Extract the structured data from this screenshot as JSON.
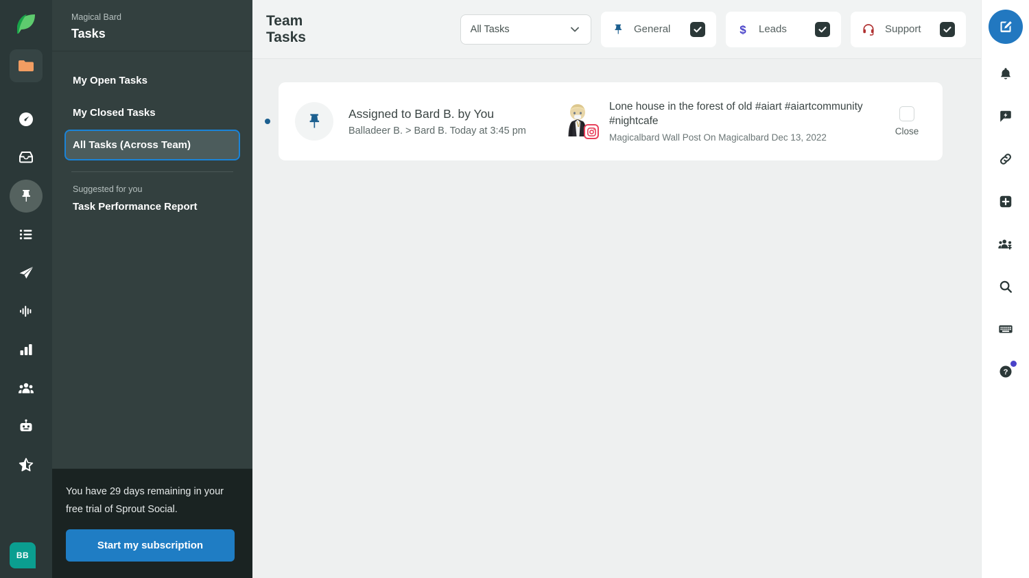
{
  "icon_rail": {
    "logo": "sprout-leaf-logo",
    "folder_icon": "folder-icon",
    "items": [
      {
        "name": "dashboard-icon",
        "label": "Dashboard"
      },
      {
        "name": "inbox-icon",
        "label": "Smart Inbox"
      },
      {
        "name": "pin-icon",
        "label": "Tasks",
        "active": true
      },
      {
        "name": "list-icon",
        "label": "Feeds"
      },
      {
        "name": "paper-plane-icon",
        "label": "Publishing"
      },
      {
        "name": "listening-icon",
        "label": "Listening"
      },
      {
        "name": "bar-chart-icon",
        "label": "Reports"
      },
      {
        "name": "people-icon",
        "label": "Contacts"
      },
      {
        "name": "bot-icon",
        "label": "Bots"
      },
      {
        "name": "star-icon",
        "label": "Reviews"
      }
    ],
    "user_avatar_initials": "BB"
  },
  "nav": {
    "org": "Magical Bard",
    "title": "Tasks",
    "items": [
      {
        "label": "My Open Tasks",
        "selected": false
      },
      {
        "label": "My Closed Tasks",
        "selected": false
      },
      {
        "label": "All Tasks (Across Team)",
        "selected": true
      }
    ],
    "suggested_label": "Suggested for you",
    "suggested_item": "Task Performance Report",
    "trial_text": "You have 29 days remaining in your free trial of Sprout Social.",
    "trial_button": "Start my subscription"
  },
  "topbar": {
    "page_title": "Team Tasks",
    "filter_select": {
      "value": "All Tasks",
      "icon": "chevron-down-icon"
    },
    "chips": [
      {
        "label": "General",
        "icon": "pin-icon",
        "checked": true,
        "check_icon": "checkmark-icon"
      },
      {
        "label": "Leads",
        "icon": "dollar-icon",
        "checked": true,
        "check_icon": "checkmark-icon"
      },
      {
        "label": "Support",
        "icon": "headset-icon",
        "checked": true,
        "check_icon": "checkmark-icon"
      }
    ]
  },
  "task_card": {
    "pin_icon": "pin-icon",
    "assigned_title": "Assigned to Bard B. by You",
    "assigned_sub": "Balladeer B. > Bard B. Today at 3:45 pm",
    "avatar": "profile-avatar",
    "network_badge": "instagram-icon",
    "post_text": "Lone house in the forest of old #aiart #aiartcommunity #nightcafe",
    "post_meta": "Magicalbard Wall Post On Magicalbard Dec 13, 2022",
    "close_label": "Close"
  },
  "right_rail": {
    "compose": {
      "label": "Compose",
      "icon": "compose-pencil-icon"
    },
    "items": [
      {
        "name": "bell-icon",
        "label": "Notifications"
      },
      {
        "name": "message-bolt-icon",
        "label": "Messages"
      },
      {
        "name": "link-icon",
        "label": "Link"
      },
      {
        "name": "plus-square-icon",
        "label": "Add"
      },
      {
        "name": "add-people-icon",
        "label": "Invite"
      },
      {
        "name": "search-icon",
        "label": "Search"
      },
      {
        "name": "keyboard-icon",
        "label": "Shortcuts"
      },
      {
        "name": "help-icon",
        "label": "Help",
        "badge": true
      }
    ]
  },
  "colors": {
    "rail_bg": "#2b3838",
    "nav_bg": "#33403f",
    "accent_blue": "#1f7dc4",
    "focus_blue": "#1a84d9",
    "trial_bg": "#1a2322",
    "teal_avatar": "#0b9e90",
    "content_bg": "#eef0f0",
    "topbar_bg": "#f1f3f3",
    "pin_blue": "#1c5f8f",
    "leads_purple": "#4a43c9",
    "support_red": "#b03030",
    "instagram_red": "#e8415c"
  }
}
